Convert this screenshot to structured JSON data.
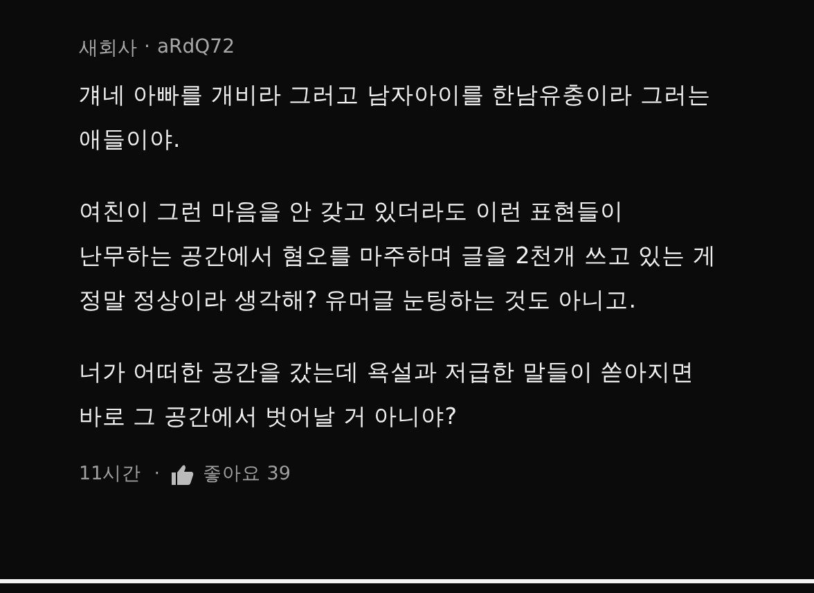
{
  "comment": {
    "author": "새회사",
    "separator": "·",
    "username": "aRdQ72",
    "paragraphs": [
      [
        "걔네 아빠를 개비라 그러고 남자아이를 한남유충이라 그러는",
        "애들이야."
      ],
      [
        "여친이 그런 마음을 안 갖고 있더라도 이런 표현들이",
        "난무하는 공간에서 혐오를 마주하며 글을 2천개 쓰고 있는 게",
        "정말 정상이라 생각해? 유머글 눈팅하는 것도 아니고."
      ],
      [
        "너가 어떠한 공간을 갔는데 욕설과 저급한 말들이 쏟아지면",
        "바로 그 공간에서 벗어날 거 아니야?"
      ]
    ],
    "time": "11시간",
    "footer_separator": "·",
    "like_label": "좋아요 39"
  }
}
